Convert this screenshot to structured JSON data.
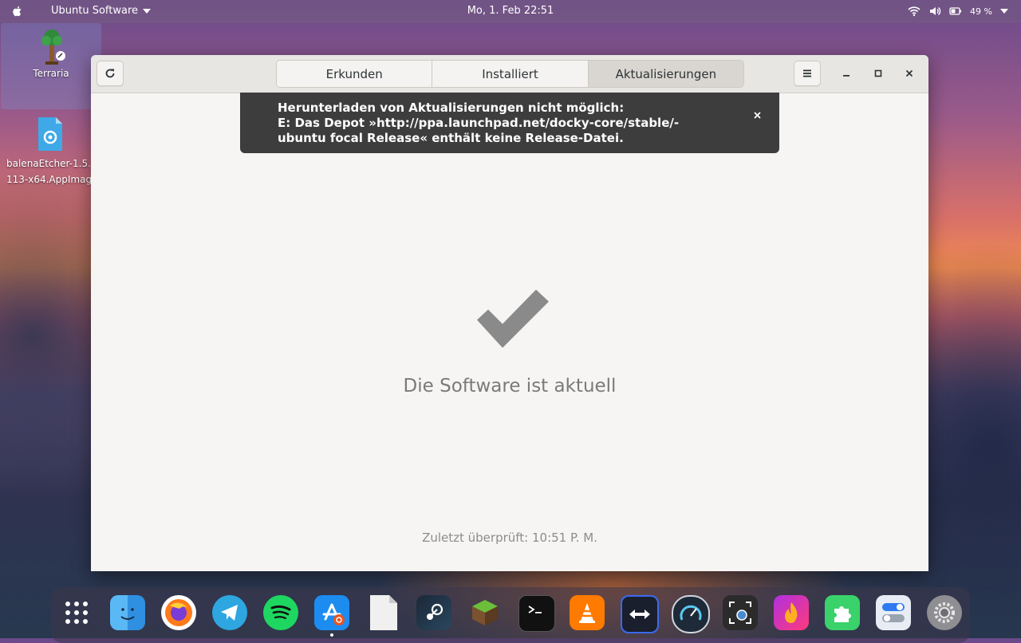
{
  "topbar": {
    "app_name": "Ubuntu Software",
    "clock": "Mo,  1. Feb  22:51",
    "battery": "49 %"
  },
  "desktop": {
    "icons": [
      {
        "label": "Terraria"
      },
      {
        "label": "balenaEtcher-1.5.\n113-x64.AppImage"
      }
    ]
  },
  "window": {
    "tabs": [
      "Erkunden",
      "Installiert",
      "Aktualisierungen"
    ],
    "active_tab": "Aktualisierungen",
    "notification": {
      "line1": "Herunterladen von Aktualisierungen nicht möglich:",
      "line2": "E: Das Depot »http://ppa.launchpad.net/docky-core/stable/-",
      "line3": "ubuntu focal Release« enthält keine Release-Datei."
    },
    "status": "Die Software ist aktuell",
    "last_checked": "Zuletzt überprüft: 10:51 P. M."
  },
  "dock": {
    "apps": [
      "app-grid",
      "finder",
      "firefox",
      "telegram",
      "spotify",
      "software-center",
      "files",
      "steam",
      "minecraft",
      "terminal",
      "vlc",
      "teamviewer",
      "stacer",
      "screenshot",
      "spark",
      "extensions",
      "tweaks",
      "settings"
    ]
  },
  "colors": {
    "accent_bar": "#3d3d3d",
    "window_bg": "#f6f5f4"
  }
}
